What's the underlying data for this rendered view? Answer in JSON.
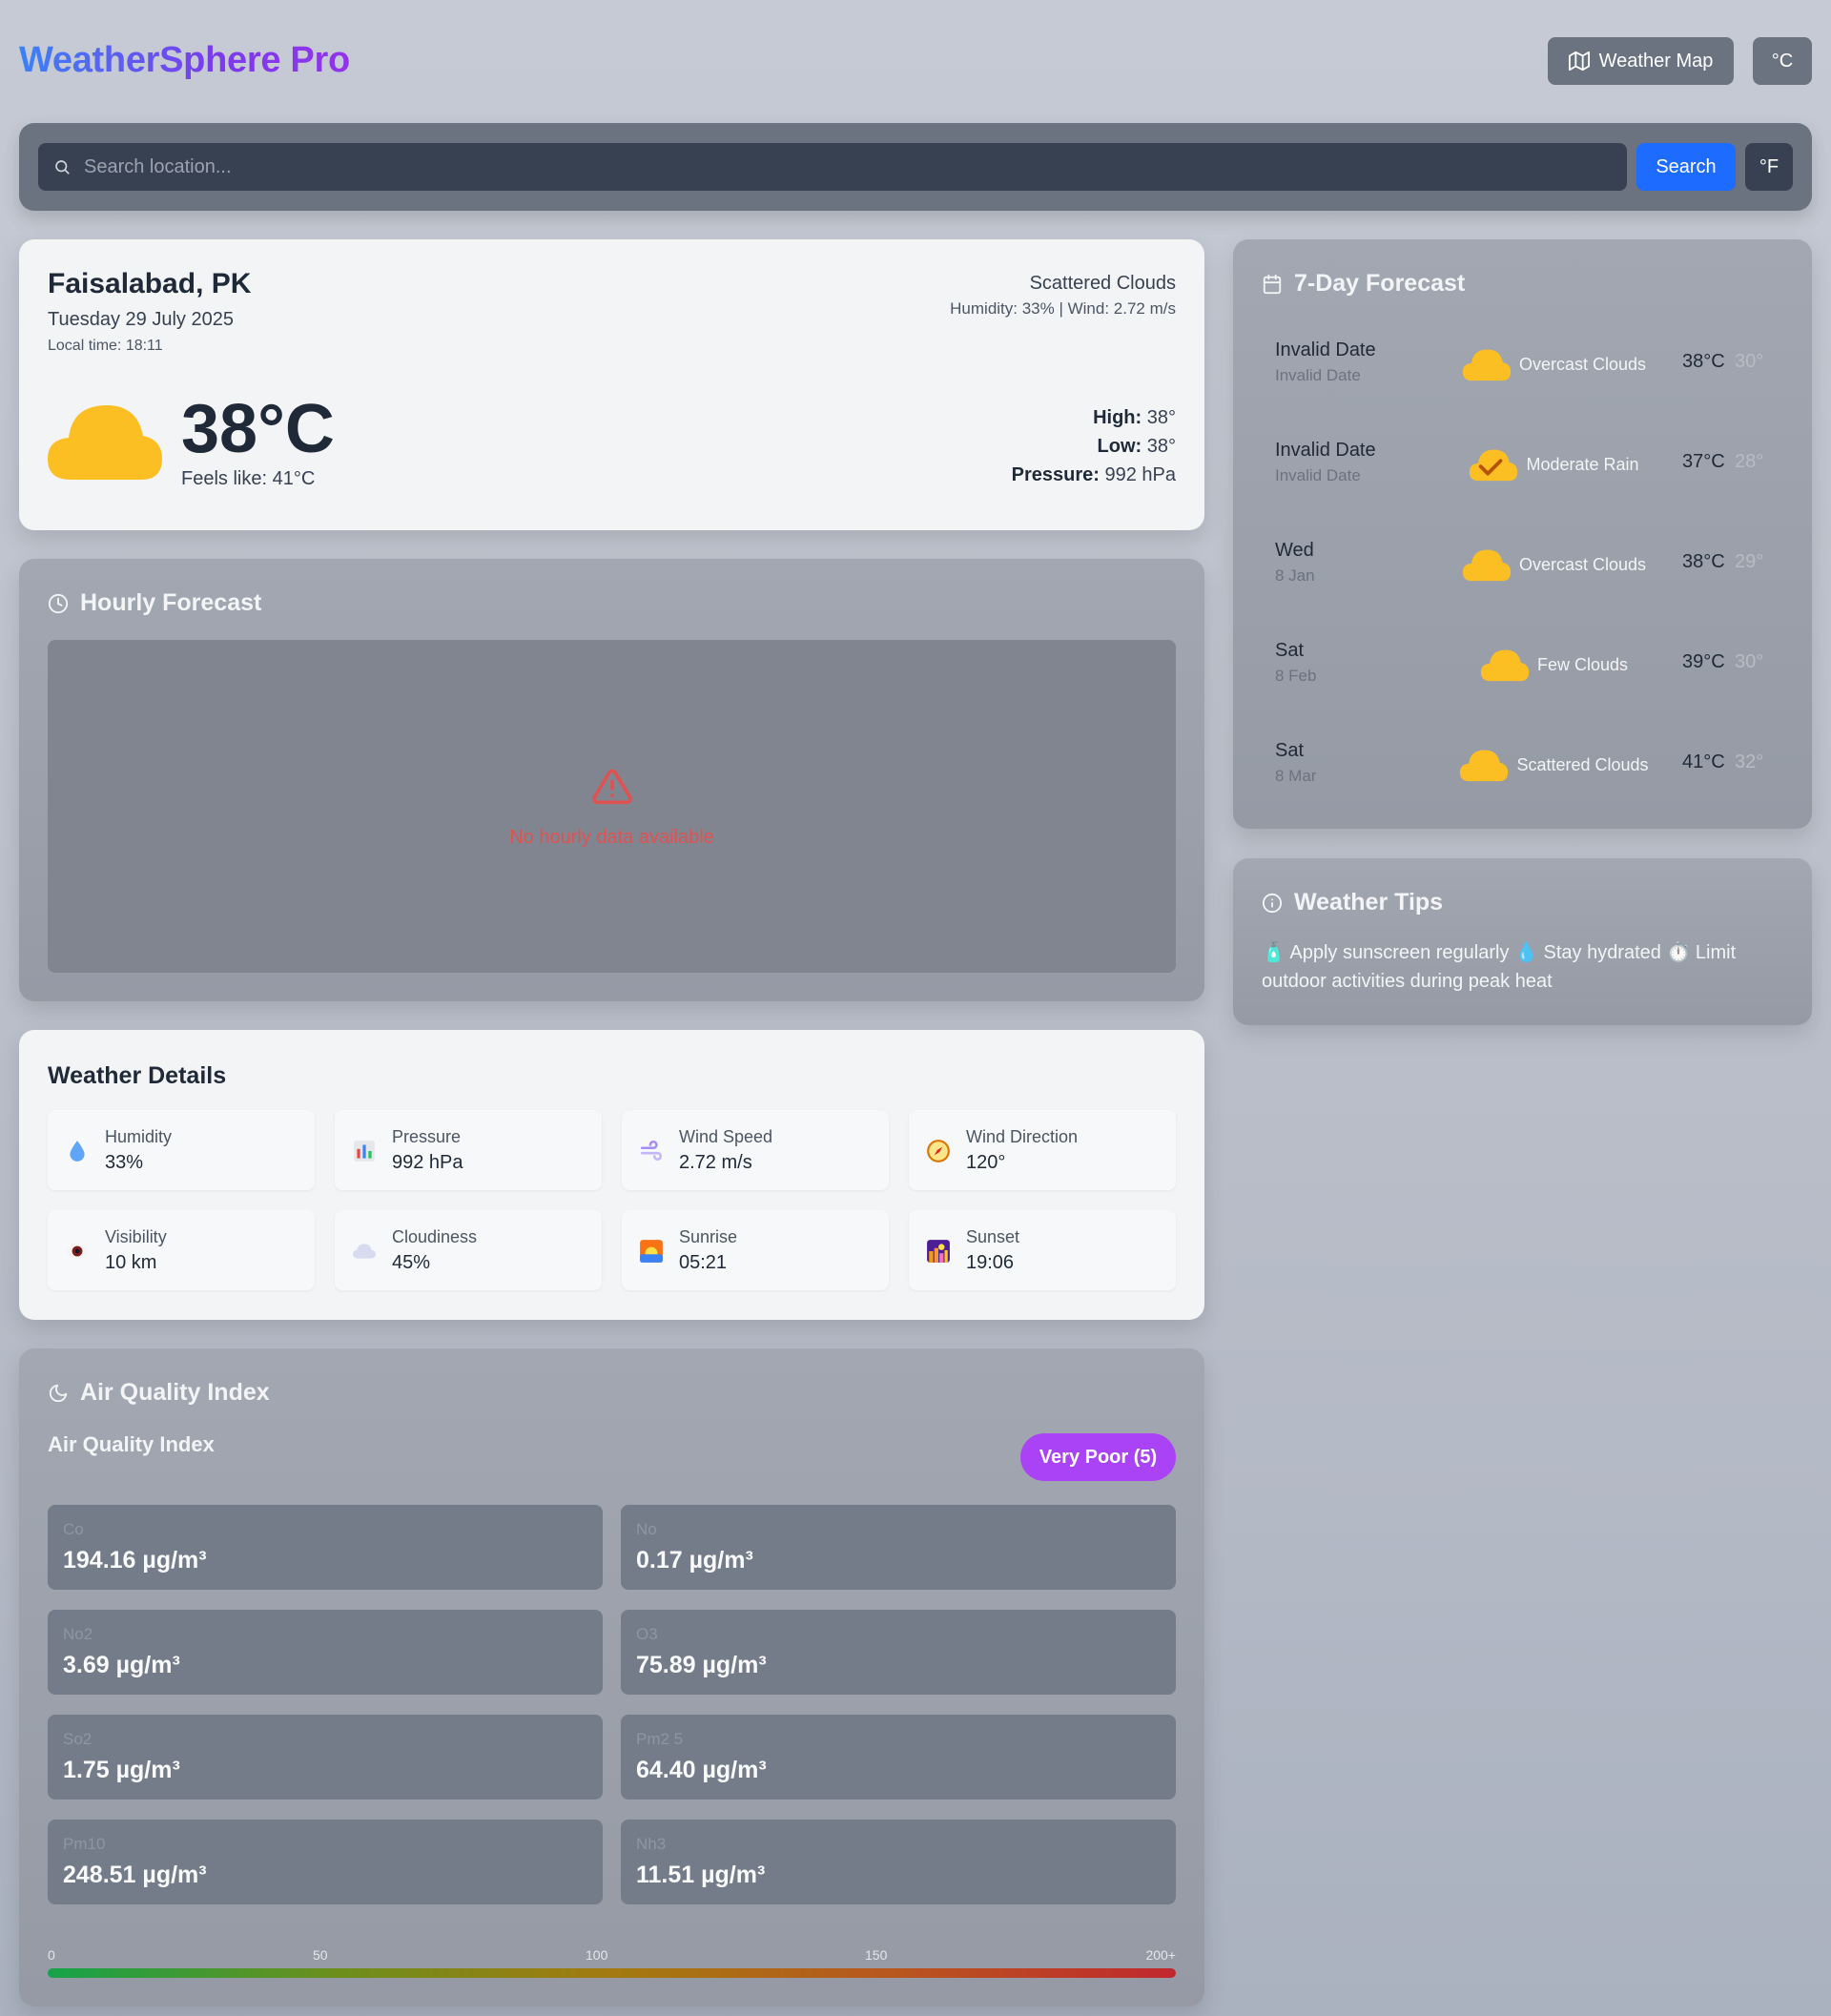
{
  "header": {
    "brand": "WeatherSphere Pro",
    "map_label": "Weather Map",
    "unit_label": "°C"
  },
  "search": {
    "placeholder": "Search location...",
    "button_label": "Search",
    "unit_toggle": "°F"
  },
  "current": {
    "city": "Faisalabad, PK",
    "date": "Tuesday 29 July 2025",
    "local_time": "Local time: 18:11",
    "description": "Scattered Clouds",
    "humidity_wind": "Humidity: 33% | Wind: 2.72 m/s",
    "temperature": "38°C",
    "feels_like": "Feels like: 41°C",
    "high_label": "High:",
    "high_value": " 38°",
    "low_label": "Low:",
    "low_value": " 38°",
    "pressure_label": "Pressure:",
    "pressure_value": " 992 hPa",
    "icon": "cloud-icon"
  },
  "hourly": {
    "title": "Hourly Forecast",
    "empty_message": "No hourly data available"
  },
  "details": {
    "title": "Weather Details",
    "items": [
      {
        "label": "Humidity",
        "value": "33%",
        "icon": "droplet-icon"
      },
      {
        "label": "Pressure",
        "value": "992 hPa",
        "icon": "bar-chart-icon"
      },
      {
        "label": "Wind Speed",
        "value": "2.72 m/s",
        "icon": "wind-icon"
      },
      {
        "label": "Wind Direction",
        "value": "120°",
        "icon": "compass-icon"
      },
      {
        "label": "Visibility",
        "value": "10 km",
        "icon": "eye-icon"
      },
      {
        "label": "Cloudiness",
        "value": "45%",
        "icon": "cloud-icon"
      },
      {
        "label": "Sunrise",
        "value": "05:21",
        "icon": "sunrise-icon"
      },
      {
        "label": "Sunset",
        "value": "19:06",
        "icon": "sunset-icon"
      }
    ]
  },
  "aqi": {
    "title": "Air Quality Index",
    "subtitle": "Air Quality Index",
    "badge": "Very Poor (5)",
    "badge_color": "#a943f5",
    "pollutants": [
      {
        "name": "Co",
        "value": "194.16 µg/m³"
      },
      {
        "name": "No",
        "value": "0.17 µg/m³"
      },
      {
        "name": "No2",
        "value": "3.69 µg/m³"
      },
      {
        "name": "O3",
        "value": "75.89 µg/m³"
      },
      {
        "name": "So2",
        "value": "1.75 µg/m³"
      },
      {
        "name": "Pm2 5",
        "value": "64.40 µg/m³"
      },
      {
        "name": "Pm10",
        "value": "248.51 µg/m³"
      },
      {
        "name": "Nh3",
        "value": "11.51 µg/m³"
      }
    ],
    "scale": [
      "0",
      "50",
      "100",
      "150",
      "200+"
    ]
  },
  "forecast": {
    "title": "7-Day Forecast",
    "days": [
      {
        "day": "Invalid Date",
        "date": "Invalid Date",
        "condition": "Overcast Clouds",
        "high": "38°C",
        "low": "30°",
        "icon": "cloud-icon"
      },
      {
        "day": "Invalid Date",
        "date": "Invalid Date",
        "condition": "Moderate Rain",
        "high": "37°C",
        "low": "28°",
        "icon": "cloud-check-icon"
      },
      {
        "day": "Wed",
        "date": "8 Jan",
        "condition": "Overcast Clouds",
        "high": "38°C",
        "low": "29°",
        "icon": "cloud-icon"
      },
      {
        "day": "Sat",
        "date": "8 Feb",
        "condition": "Few Clouds",
        "high": "39°C",
        "low": "30°",
        "icon": "cloud-icon"
      },
      {
        "day": "Sat",
        "date": "8 Mar",
        "condition": "Scattered Clouds",
        "high": "41°C",
        "low": "32°",
        "icon": "cloud-icon"
      }
    ]
  },
  "tips": {
    "title": "Weather Tips",
    "text": "🧴 Apply sunscreen regularly 💧 Stay hydrated ⏱️ Limit outdoor activities during peak heat"
  },
  "colors": {
    "accent": "#1d6bff",
    "cloud": "#fbbf24",
    "error": "#e05252"
  }
}
